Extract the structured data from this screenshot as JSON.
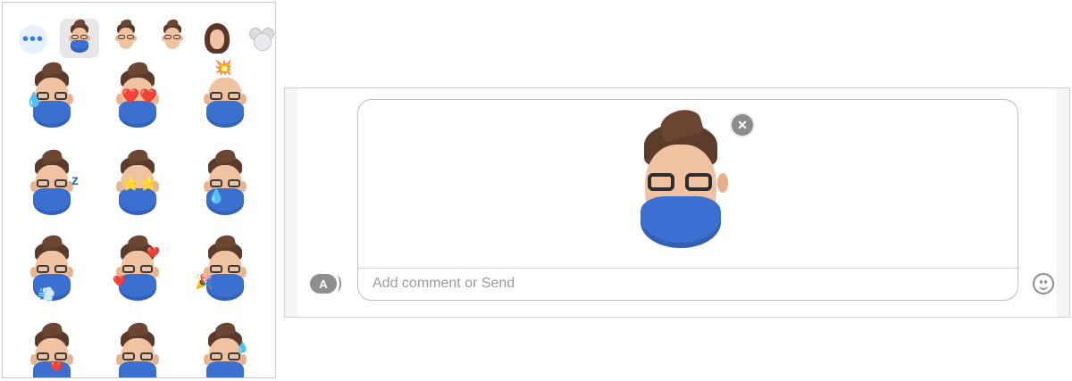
{
  "picker": {
    "more_glyph": "•••",
    "tabs": [
      {
        "icon": "memoji-masked-icon",
        "active": true
      },
      {
        "icon": "memoji-man-icon",
        "active": false
      },
      {
        "icon": "memoji-man-alt-icon",
        "active": false
      },
      {
        "icon": "memoji-woman-icon",
        "active": false
      },
      {
        "icon": "mouse-icon",
        "active": false
      }
    ],
    "stickers": [
      {
        "icon": "memoji-crying-sticker",
        "extra": "💧"
      },
      {
        "icon": "memoji-heart-eyes-sticker",
        "extra": "❤️"
      },
      {
        "icon": "memoji-mind-blown-sticker",
        "extra": "💥"
      },
      {
        "icon": "memoji-sleeping-sticker",
        "extra": "z"
      },
      {
        "icon": "memoji-star-struck-sticker",
        "extra": "⭐"
      },
      {
        "icon": "memoji-sweat-sticker",
        "extra": "💧"
      },
      {
        "icon": "memoji-huffing-sticker",
        "extra": "💨"
      },
      {
        "icon": "memoji-love-sticker",
        "extra": "❤️"
      },
      {
        "icon": "memoji-party-sticker",
        "extra": "🎉"
      },
      {
        "icon": "memoji-kiss-sticker",
        "extra": "❤️"
      },
      {
        "icon": "memoji-swearing-sticker",
        "extra": ""
      },
      {
        "icon": "memoji-nervous-sweat-sticker",
        "extra": "💧"
      }
    ]
  },
  "compose": {
    "sticker": "memoji-wink-sticker",
    "remove_glyph": "✕",
    "comment_placeholder": "Add comment or Send",
    "apps_glyph": "A"
  }
}
